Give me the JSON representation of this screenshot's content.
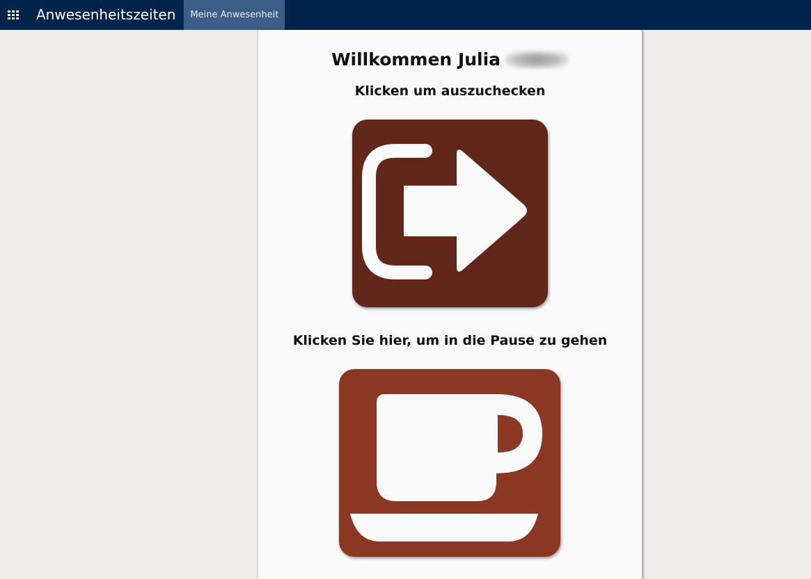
{
  "navbar": {
    "apps_icon": "apps-grid-icon",
    "app_title": "Anwesenheitszeiten",
    "menu_item": "Meine Anwesenheit"
  },
  "main": {
    "welcome_text": "Willkommen Julia",
    "checkout_label": "Klicken um auszuchecken",
    "checkout_icon": "sign-out-icon",
    "break_label": "Klicken Sie hier, um in die Pause zu gehen",
    "break_icon": "coffee-cup-icon"
  },
  "colors": {
    "navbar": "#00234b",
    "menu_active": "#3d5d87",
    "checkout_tile": "#60271a",
    "break_tile": "#8a3724",
    "background": "#eeedeb",
    "sheet": "#fafafb"
  }
}
